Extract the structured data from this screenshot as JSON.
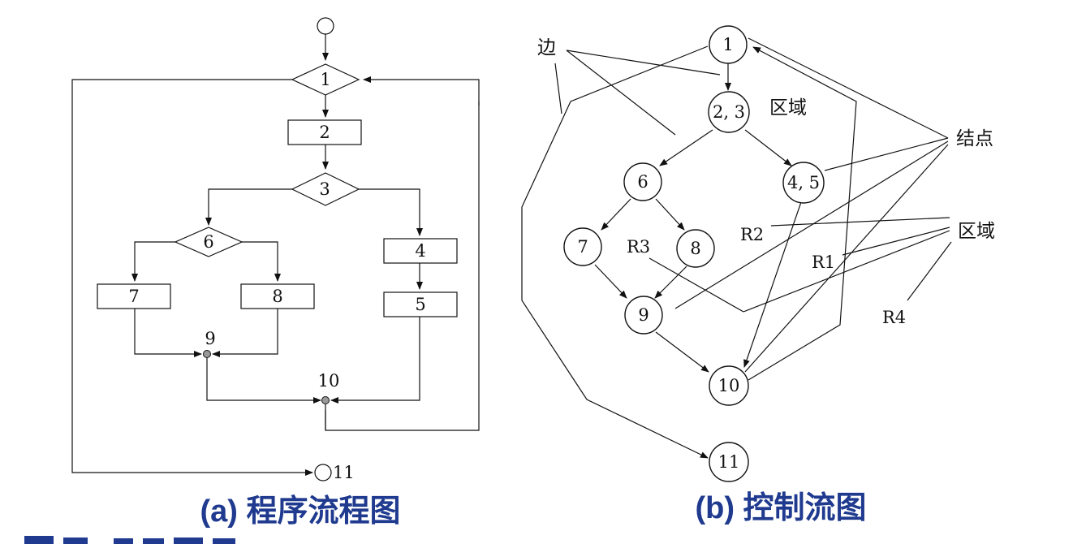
{
  "flowchart": {
    "caption": "(a) 程序流程图",
    "labels": {
      "n1": "1",
      "n2": "2",
      "n3": "3",
      "n4": "4",
      "n5": "5",
      "n6": "6",
      "n7": "7",
      "n8": "8",
      "n9": "9",
      "n10": "10",
      "n11": "11"
    }
  },
  "control_flow_graph": {
    "caption": "(b) 控制流图",
    "nodes": {
      "n1": "1",
      "n23": "2, 3",
      "n45": "4, 5",
      "n6": "6",
      "n7": "7",
      "n8": "8",
      "n9": "9",
      "n10": "10",
      "n11": "11"
    },
    "annotations": {
      "edge": "边",
      "region_top": "区域",
      "node": "结点",
      "region": "区域"
    },
    "regions": {
      "r1": "R1",
      "r2": "R2",
      "r3": "R3",
      "r4": "R4"
    }
  }
}
